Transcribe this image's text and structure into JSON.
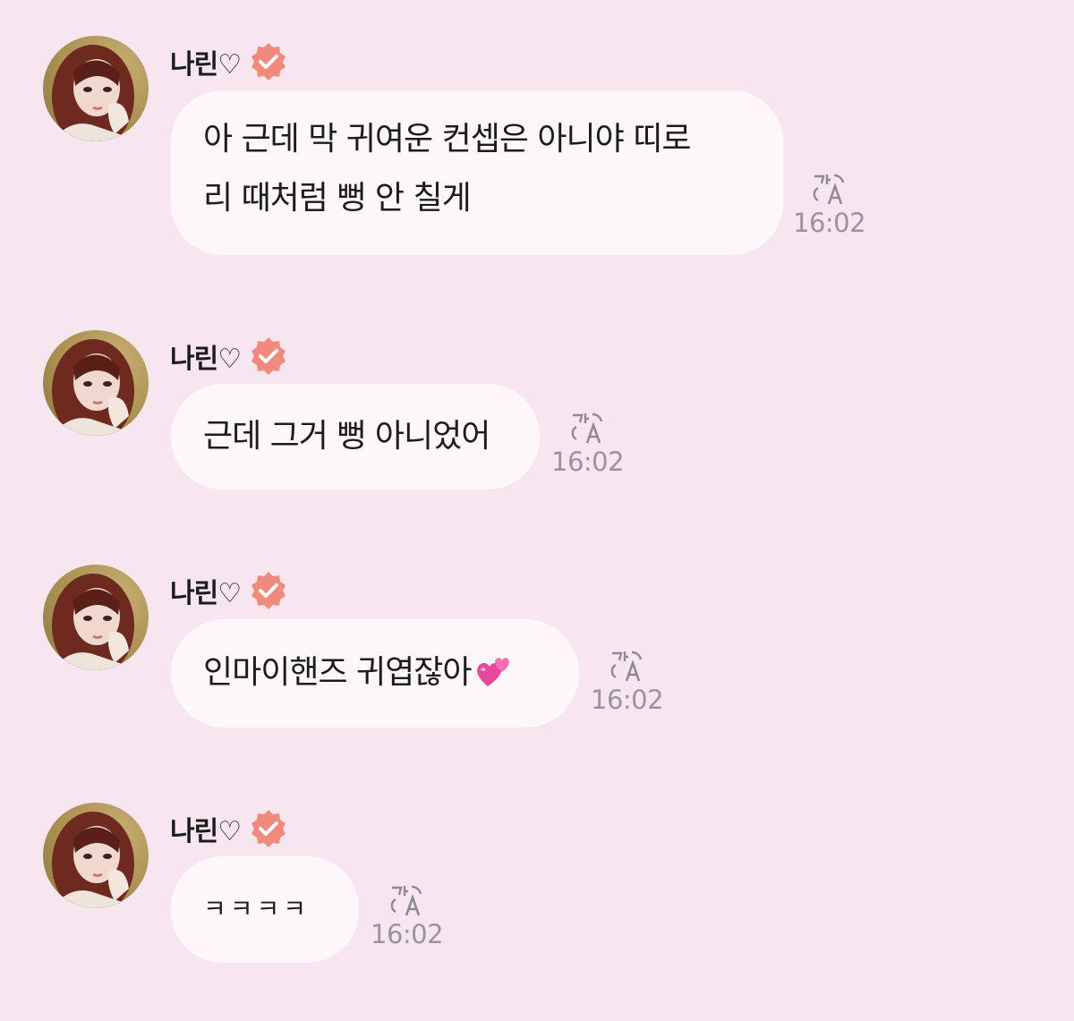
{
  "sender": {
    "name": "나린♡",
    "verified_icon": "verified-check-badge",
    "avatar": "profile-photo"
  },
  "colors": {
    "background": "#f7e6ef",
    "bubble": "#fdf7f9",
    "verified_badge": "#ef8a7c",
    "timestamp": "#9a9598"
  },
  "messages": [
    {
      "lines": [
        "아 근데 막 귀여운 컨셉은 아니야 띠로",
        "리 때처럼 뻥 안 칠게"
      ],
      "time": "16:02",
      "translate_icon": "translate-icon"
    },
    {
      "lines": [
        "근데 그거 뻥 아니었어"
      ],
      "time": "16:02",
      "translate_icon": "translate-icon"
    },
    {
      "lines": [
        "인마이핸즈 귀엽잖아"
      ],
      "emoji": "💕",
      "time": "16:02",
      "translate_icon": "translate-icon"
    },
    {
      "lines": [
        "ㅋㅋㅋㅋ"
      ],
      "time": "16:02",
      "translate_icon": "translate-icon"
    }
  ]
}
